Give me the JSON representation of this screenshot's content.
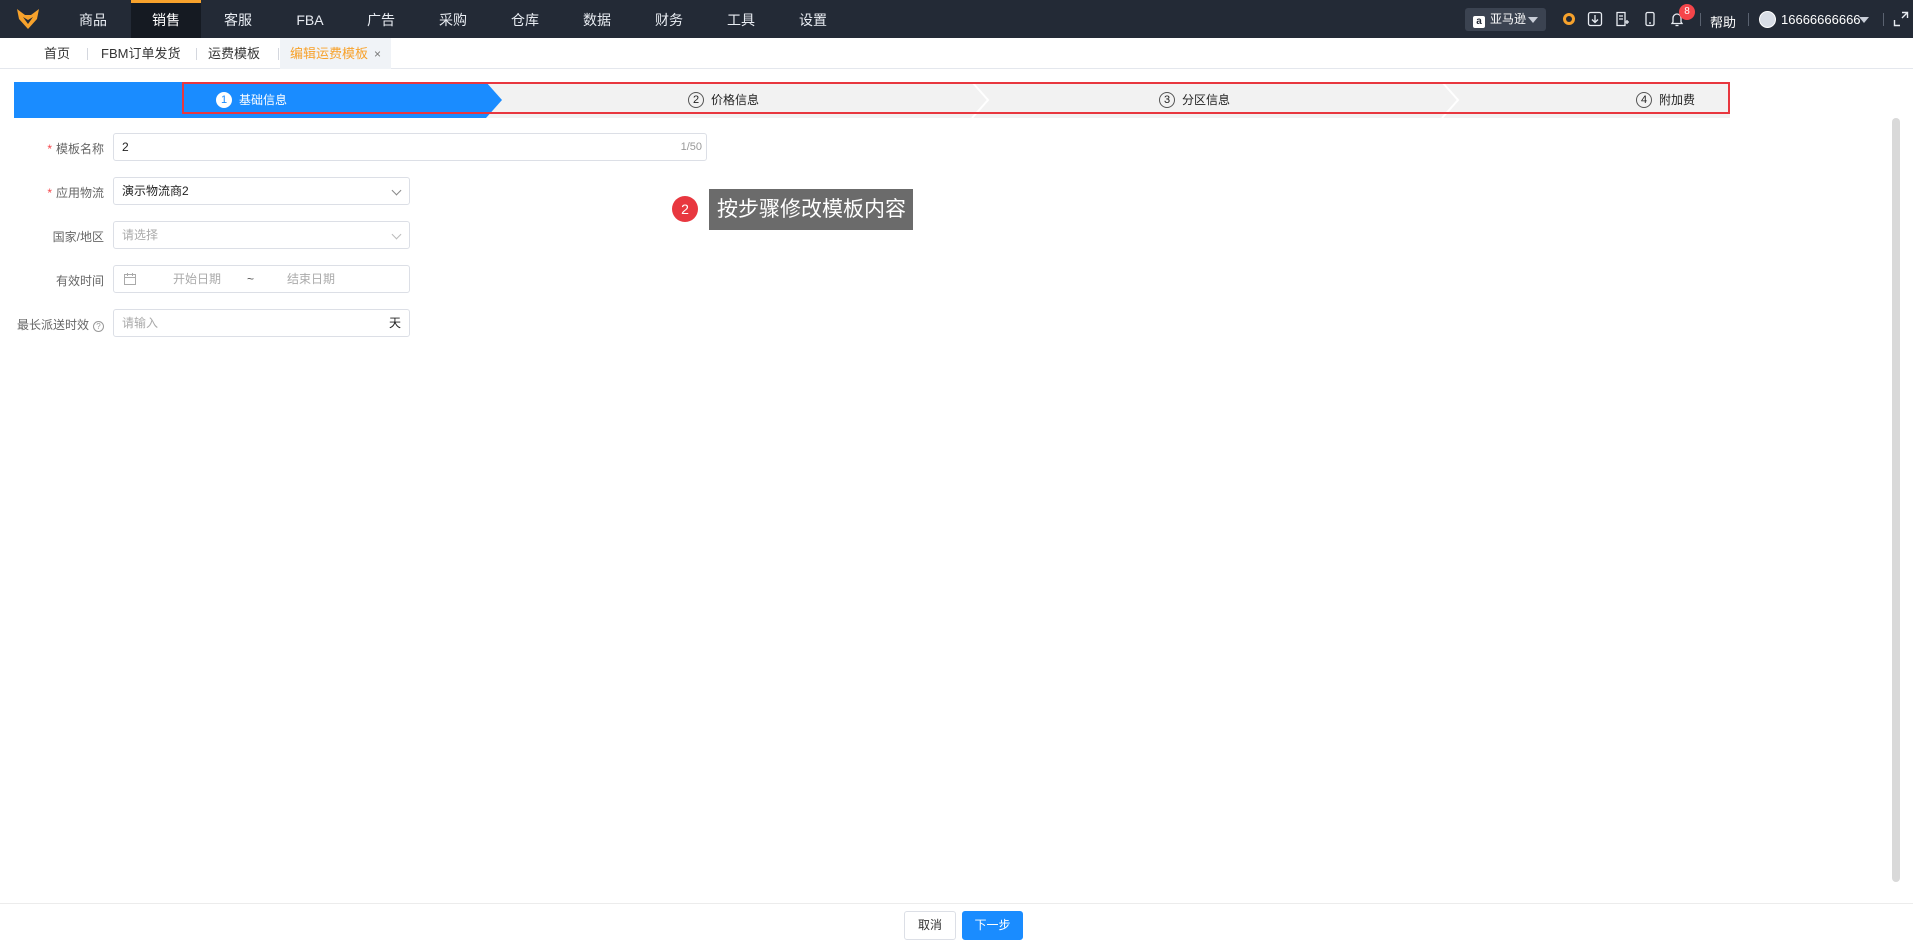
{
  "top_nav": {
    "items": [
      "商品",
      "销售",
      "客服",
      "FBA",
      "广告",
      "采购",
      "仓库",
      "数据",
      "财务",
      "工具",
      "设置"
    ],
    "active_index": 1,
    "marketplace": "亚马逊",
    "notification_count": "8",
    "help": "帮助",
    "username": "16666666666"
  },
  "tabs": {
    "items": [
      "首页",
      "FBM订单发货",
      "运费模板",
      "编辑运费模板"
    ],
    "active_index": 3,
    "close": "×"
  },
  "steps": {
    "items": [
      {
        "num": "1",
        "label": "基础信息"
      },
      {
        "num": "2",
        "label": "价格信息"
      },
      {
        "num": "3",
        "label": "分区信息"
      },
      {
        "num": "4",
        "label": "附加费"
      }
    ],
    "active_index": 0
  },
  "form": {
    "template_name": {
      "label": "模板名称",
      "value": "2",
      "counter": "1/50"
    },
    "logistics": {
      "label": "应用物流",
      "value": "演示物流商2"
    },
    "country": {
      "label": "国家/地区",
      "placeholder": "请选择"
    },
    "valid_time": {
      "label": "有效时间",
      "start_placeholder": "开始日期",
      "separator": "~",
      "end_placeholder": "结束日期"
    },
    "max_delivery": {
      "label": "最长派送时效",
      "placeholder": "请输入",
      "unit": "天"
    }
  },
  "annotation": {
    "number": "2",
    "text": "按步骤修改模板内容"
  },
  "footer": {
    "cancel": "取消",
    "next": "下一步"
  },
  "colors": {
    "nav_bg": "#232a36",
    "accent_orange": "#f7a22c",
    "primary_blue": "#1a8cff",
    "highlight_red": "#e8373f"
  }
}
